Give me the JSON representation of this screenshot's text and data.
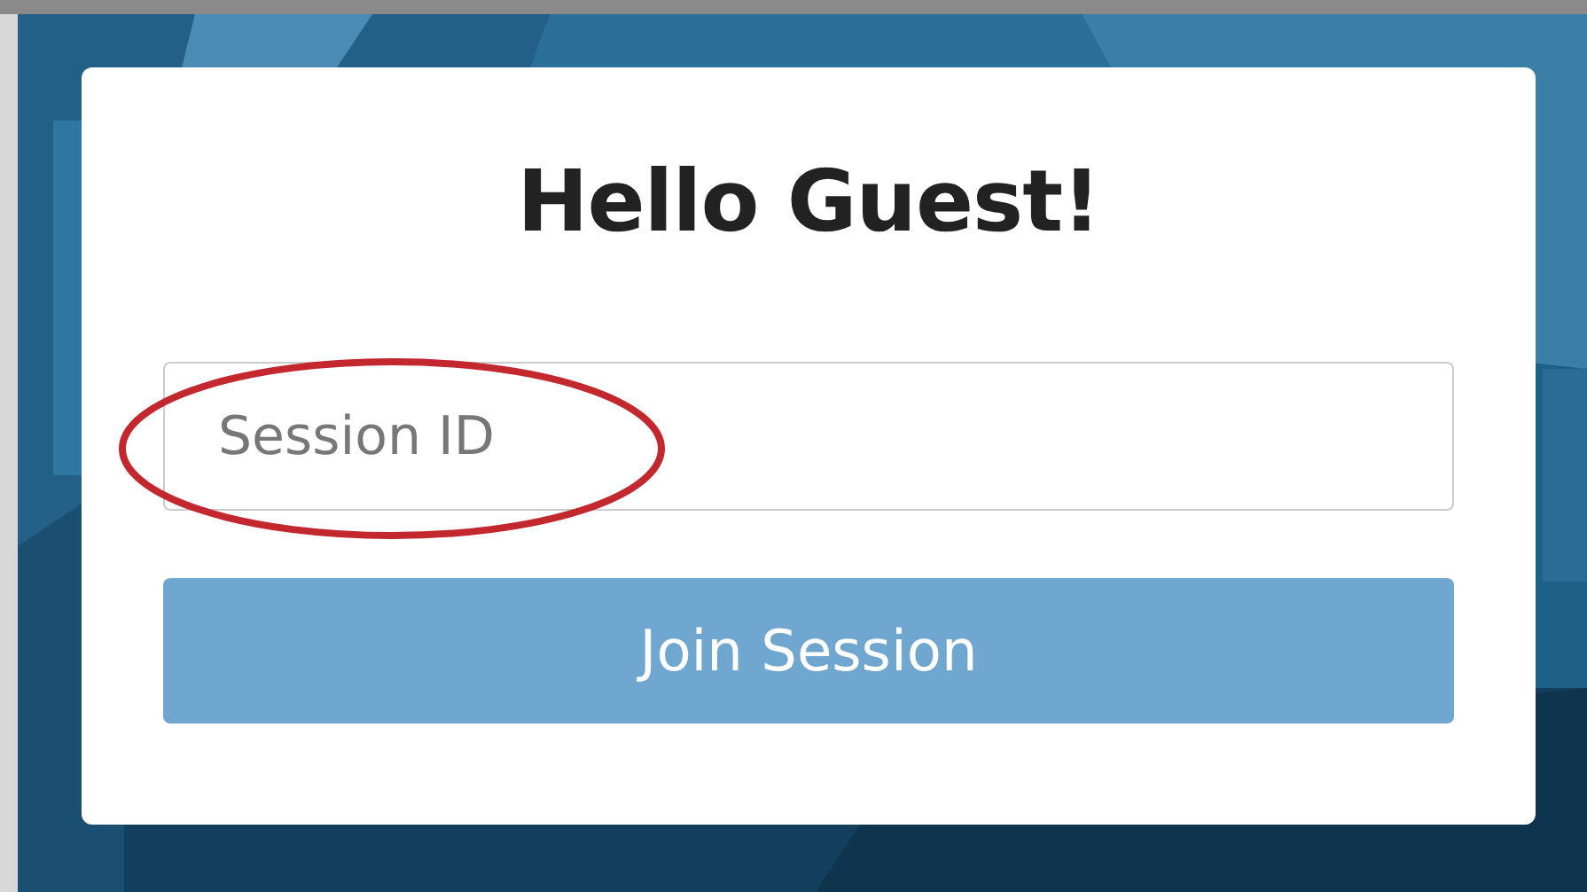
{
  "card": {
    "title": "Hello Guest!",
    "session_field": {
      "placeholder": "Session ID"
    },
    "join_button": {
      "label": "Join Session"
    }
  },
  "annotation": {
    "kind": "ellipse"
  }
}
